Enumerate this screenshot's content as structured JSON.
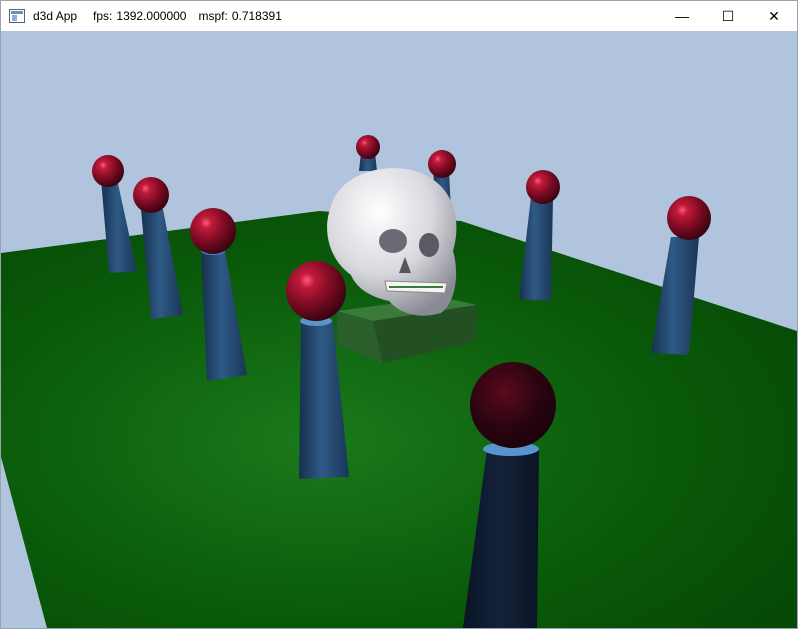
{
  "window": {
    "title": "d3d App",
    "fps_label": "fps:",
    "fps_value": "1392.000000",
    "mspf_label": "mspf:",
    "mspf_value": "0.718391",
    "buttons": {
      "minimize": "—",
      "maximize": "☐",
      "close": "✕"
    }
  },
  "scene": {
    "sky_color": "#b0c4de",
    "floor_color": "#0a6a0a",
    "pedestal_color": "#2a5a2a",
    "column_color": "#22466a",
    "sphere_color": "#8a0f2a",
    "skull_color": "#e6e6ea"
  }
}
